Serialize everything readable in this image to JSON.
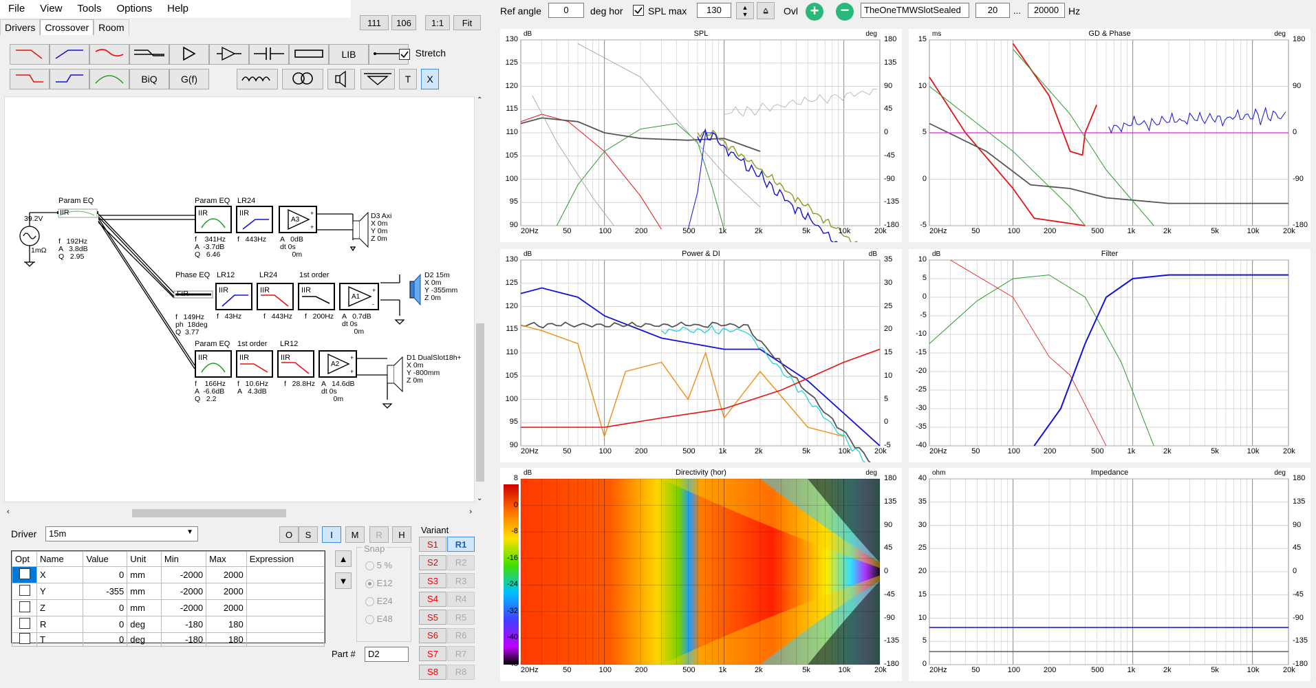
{
  "menu": [
    "File",
    "View",
    "Tools",
    "Options",
    "Help"
  ],
  "tabs": [
    "Drivers",
    "Crossover",
    "Room"
  ],
  "top_buttons": [
    "111",
    "106",
    "1:1",
    "Fit"
  ],
  "toolbar": {
    "ref_angle_label": "Ref angle",
    "ref_angle_value": "0",
    "deg_hor": "deg hor",
    "spl_max_label": "SPL max",
    "spl_max_value": "130",
    "ovl_label": "Ovl",
    "project": "TheOneTMWSlotSealed",
    "f_min": "20",
    "dots": "...",
    "f_max": "20000",
    "hz": "Hz"
  },
  "tool_labels": {
    "lib": "LIB",
    "biq": "BiQ",
    "gf": "G(f)",
    "t": "T",
    "x": "X",
    "stretch": "Stretch"
  },
  "schematic": {
    "source_v": "39.2V",
    "source_r": "1mΩ",
    "paramEQ_top_title": "Param EQ",
    "paramEQ_top_type": "IIR",
    "paramEQ_top_params": "f   192Hz\nA   3.8dB\nQ   2.95",
    "row1": {
      "peq_title": "Param EQ",
      "peq_params": "f    341Hz\nA  -3.7dB\nQ   6.46",
      "lr_title": "LR24",
      "lr_params": "f   443Hz",
      "amp_label": "A3",
      "amp_params": "A   0dB\ndt 0s\n      0m",
      "drv": "D3 Axi\nX 0m\nY 0m\nZ 0m"
    },
    "row2": {
      "peq_title": "Phase EQ",
      "peq_type": "FIR",
      "peq_params": "f   149Hz\nph  18deg\nQ  3.77",
      "lr1_title": "LR12",
      "lr1_params": "f   43Hz",
      "lr2_title": "LR24",
      "lr2_params": "f   443Hz",
      "fo_title": "1st order",
      "fo_params": "f   200Hz",
      "amp_label": "A1",
      "amp_params": "A   0.7dB\ndt 0s\n      0m",
      "drv": "D2 15m\nX 0m\nY -355mm\nZ 0m"
    },
    "row3": {
      "peq_title": "Param EQ",
      "peq_params": "f    166Hz\nA  -6.6dB\nQ   2.2",
      "fo_title": "1st order",
      "fo_params": "f   10.6Hz\nA   4.3dB",
      "lr_title": "LR12",
      "lr_params": "f   28.8Hz",
      "amp_label": "A2",
      "amp_params": "A   14.6dB\ndt 0s\n      0m",
      "drv": "D1 DualSlot18h+\nX 0m\nY -800mm\nZ 0m"
    },
    "iir": "IIR"
  },
  "driver": {
    "label": "Driver",
    "value": "15m",
    "mode_buttons": [
      "O",
      "S",
      "I",
      "M",
      "R",
      "H"
    ]
  },
  "params_table": {
    "headers": [
      "Opt",
      "Name",
      "Value",
      "Unit",
      "Min",
      "Max",
      "Expression"
    ],
    "rows": [
      [
        "",
        "X",
        "0",
        "mm",
        "-2000",
        "2000",
        ""
      ],
      [
        "",
        "Y",
        "-355",
        "mm",
        "-2000",
        "2000",
        ""
      ],
      [
        "",
        "Z",
        "0",
        "mm",
        "-2000",
        "2000",
        ""
      ],
      [
        "",
        "R",
        "0",
        "deg",
        "-180",
        "180",
        ""
      ],
      [
        "",
        "T",
        "0",
        "deg",
        "-180",
        "180",
        ""
      ]
    ]
  },
  "snap": {
    "label": "Snap",
    "options": [
      "5 %",
      "E12",
      "E24",
      "E48"
    ]
  },
  "variant": {
    "label": "Variant",
    "s": [
      "S1",
      "S2",
      "S3",
      "S4",
      "S5",
      "S6",
      "S7",
      "S8"
    ],
    "r": [
      "R1",
      "R2",
      "R3",
      "R4",
      "R5",
      "R6",
      "R7",
      "R8"
    ]
  },
  "part": {
    "label": "Part #",
    "value": "D2"
  },
  "freq_ticks": [
    "20Hz",
    "50",
    "100",
    "200",
    "500",
    "1k",
    "2k",
    "5k",
    "10k",
    "20k"
  ],
  "colors": {
    "red": "#e81010",
    "blue": "#1010d8",
    "green": "#2a9a2a",
    "grey": "#555555",
    "olive": "#8a9a20",
    "magenta": "#e020e0",
    "orange": "#f08c10",
    "cyan": "#10d0e0"
  },
  "charts": [
    {
      "id": "spl",
      "title": "SPL",
      "ylabel": "dB",
      "y2label": "deg",
      "yticks": [
        "130",
        "125",
        "120",
        "115",
        "110",
        "105",
        "100",
        "95",
        "90"
      ],
      "y2ticks": [
        "180",
        "135",
        "90",
        "45",
        "0",
        "-45",
        "-90",
        "-135",
        "-180"
      ]
    },
    {
      "id": "gd",
      "title": "GD & Phase",
      "ylabel": "ms",
      "y2label": "deg",
      "yticks": [
        "15",
        "10",
        "5",
        "0",
        "-5"
      ],
      "y2ticks": [
        "180",
        "90",
        "0",
        "-90",
        "-180"
      ]
    },
    {
      "id": "power",
      "title": "Power & DI",
      "ylabel": "dB",
      "y2label": "dB",
      "yticks": [
        "130",
        "125",
        "120",
        "115",
        "110",
        "105",
        "100",
        "95",
        "90"
      ],
      "y2ticks": [
        "35",
        "30",
        "25",
        "20",
        "15",
        "10",
        "5",
        "0",
        "-5"
      ]
    },
    {
      "id": "filter",
      "title": "Filter",
      "ylabel": "dB",
      "y2label": "",
      "yticks": [
        "10",
        "5",
        "0",
        "-5",
        "-10",
        "-15",
        "-20",
        "-25",
        "-30",
        "-35",
        "-40"
      ],
      "y2ticks": []
    },
    {
      "id": "dir",
      "title": "Directivity (hor)",
      "ylabel": "dB",
      "y2label": "deg",
      "yticks": [
        "8",
        "0",
        "-8",
        "-16",
        "-24",
        "-32",
        "-40",
        "-48"
      ],
      "y2ticks": [
        "180",
        "135",
        "90",
        "45",
        "0",
        "-45",
        "-90",
        "-135",
        "-180"
      ]
    },
    {
      "id": "imp",
      "title": "Impedance",
      "ylabel": "ohm",
      "y2label": "deg",
      "yticks": [
        "40",
        "35",
        "30",
        "25",
        "20",
        "15",
        "10",
        "5",
        "0"
      ],
      "y2ticks": [
        "180",
        "135",
        "90",
        "45",
        "0",
        "-45",
        "-90",
        "-135",
        "-180"
      ]
    }
  ]
}
